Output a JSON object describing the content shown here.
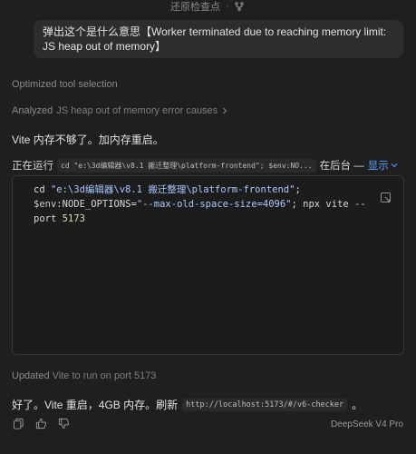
{
  "header": {
    "restore_label": "还原检查点",
    "separator": "·",
    "branch_icon": "branch-icon"
  },
  "user_message": {
    "text": "弹出这个是什么意思【Worker terminated due to reaching memory limit: JS heap out of memory】"
  },
  "status": {
    "optimized": "Optimized tool selection",
    "analyzed_prefix": "Analyzed",
    "analyzed_target": "JS heap out of memory error causes"
  },
  "assistant": {
    "line1": "Vite 内存不够了。加内存重启。",
    "running_label": "正在运行",
    "running_cmd": "cd \"e:\\3d编辑器\\v8.1 搬迁整理\\platform-frontend\"; $env:NO...",
    "running_suffix": "在后台 —",
    "show_label": "显示"
  },
  "code": {
    "part1": "cd ",
    "path": "\"e:\\3d编辑器\\v8.1 搬迁整理\\platform-frontend\"",
    "part2": ";",
    "env": "$env",
    "part3": ":NODE_OPTIONS=",
    "options": "\"--max-old-space-size=4096\"",
    "part4": "; npx vite --port ",
    "port": "5173"
  },
  "updated": {
    "prefix": "Updated",
    "target": "Vite to run on port 5173"
  },
  "final": {
    "text": "好了。Vite 重启，4GB 内存。刷新",
    "url": "http://localhost:5173/#/v6-checker",
    "end": "。"
  },
  "footer": {
    "model": "DeepSeek V4 Pro"
  },
  "colors": {
    "background": "#1f1f1f",
    "link": "#5aa0ff",
    "bubble": "#2d2d2d"
  }
}
